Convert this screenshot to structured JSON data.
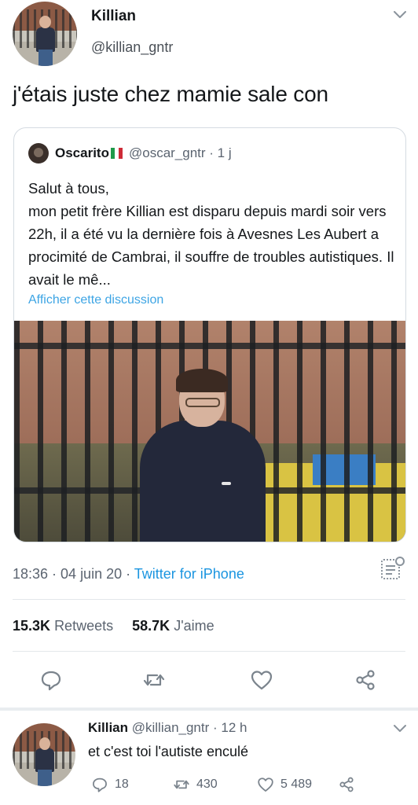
{
  "tweet": {
    "author_name": "Killian",
    "author_handle": "@killian_gntr",
    "text": "j'étais juste chez mamie sale con",
    "timestamp": "18:36 · 04 juin 20 · ",
    "source": "Twitter for iPhone",
    "retweets_count": "15.3K",
    "retweets_label": "Retweets",
    "likes_count": "58.7K",
    "likes_label": "J'aime"
  },
  "quoted_tweet": {
    "author_name": "Oscarito",
    "author_handle": "@oscar_gntr · 1 j",
    "body": "Salut à tous,\nmon petit frère Killian est disparu depuis mardi soir vers 22h, il a été vu la dernière fois à Avesnes Les Aubert a procimité de Cambrai, il souffre de troubles autistiques. Il avait le mê...",
    "show_thread": "Afficher cette discussion"
  },
  "reply": {
    "author_name": "Killian",
    "meta": "@killian_gntr · 12 h",
    "text": "et c'est toi l'autiste enculé",
    "reply_count": "18",
    "retweet_count": "430",
    "like_count": "5 489"
  },
  "colors": {
    "link_blue": "#1b95e0",
    "muted_text": "#5b6470",
    "flag_green": "#1f9a4a",
    "flag_red": "#ce2b37"
  },
  "icons": [
    "chevron-down-icon",
    "analytics-icon",
    "reply-icon",
    "retweet-icon",
    "like-icon",
    "share-icon"
  ]
}
